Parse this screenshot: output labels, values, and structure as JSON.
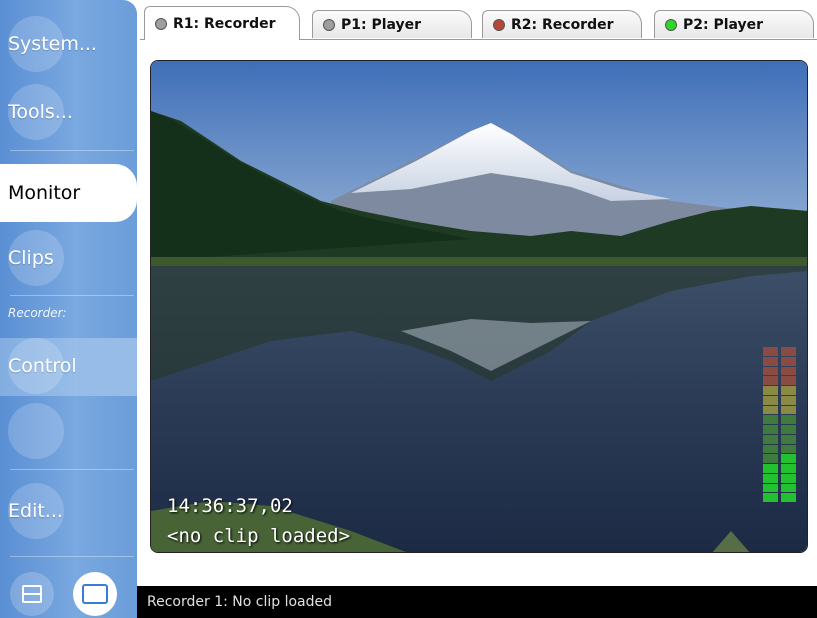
{
  "sidebar": {
    "system": "System...",
    "tools": "Tools...",
    "monitor": "Monitor",
    "clips": "Clips",
    "section_label": "Recorder:",
    "control": "Control",
    "edit": "Edit..."
  },
  "tabs": [
    {
      "label": "R1: Recorder",
      "led": "#9e9e9e",
      "active": true
    },
    {
      "label": "P1: Player",
      "led": "#9e9e9e",
      "active": false
    },
    {
      "label": "R2: Recorder",
      "led": "#b5483b",
      "active": false
    },
    {
      "label": "P2: Player",
      "led": "#2fd62a",
      "active": false
    }
  ],
  "monitor": {
    "timecode": "14:36:37,02",
    "clip_status": "<no clip loaded>"
  },
  "status": {
    "text": "Recorder 1: No clip loaded"
  },
  "colors": {
    "sidebar_blue": "#6b9dd9",
    "meter_red": "#b5483b",
    "meter_yellow": "#a89a3a",
    "meter_green": "#22c130"
  },
  "icons": {
    "split_view": "split-view-icon",
    "single_view": "single-view-icon"
  }
}
